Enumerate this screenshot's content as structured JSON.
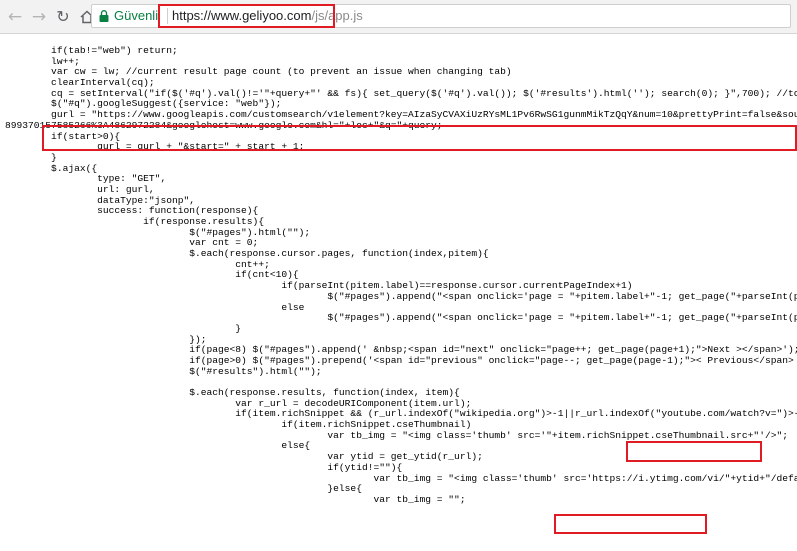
{
  "browser": {
    "secure_label": "Güvenli",
    "url_host": "https://www.geliyoo.com",
    "url_path": "/js/app.js",
    "icons": {
      "back": "back-arrow-icon",
      "forward": "forward-arrow-icon",
      "reload": "reload-icon",
      "home": "home-icon",
      "lock": "lock-icon"
    },
    "secure_color": "#0b8043"
  },
  "annotation_color": "#e01b24",
  "code_lines": [
    "        if(tab!=\"web\") return;",
    "        lw++;",
    "        var cw = lw; //current result page count (to prevent an issue when changing tab)",
    "        clearInterval(cq);",
    "        cq = setInterval(\"if($('#q').val()!='\"+query+\"' && fs){ set_query($('#q').val()); $('#results').html(''); search(0); }\",700); //to che",
    "        $(\"#q\").googleSuggest({service: \"web\"});",
    "        gurl = \"https://www.googleapis.com/customsearch/v1element?key=AIzaSyCVAXiUzRYsML1Pv6RwSG1gunmMikTzQqY&num=10&prettyPrint=false&source=",
    "899370157585266%3A4862972284&googlehost=www.google.com&hl=\"+loc+\"&q=\"+query;",
    "        if(start>0){",
    "                gurl = gurl + \"&start=\" + start + 1;",
    "        }",
    "        $.ajax({",
    "                type: \"GET\",",
    "                url: gurl,",
    "                dataType:\"jsonp\",",
    "                success: function(response){",
    "                        if(response.results){",
    "                                $(\"#pages\").html(\"\");",
    "                                var cnt = 0;",
    "                                $.each(response.cursor.pages, function(index,pitem){",
    "                                        cnt++;",
    "                                        if(cnt<10){",
    "                                                if(parseInt(pitem.label)==response.cursor.currentPageIndex+1)",
    "                                                        $(\"#pages\").append(\"<span onclick='page = \"+pitem.label+\"-1; get_page(\"+parseInt(pitem",
    "                                                else",
    "                                                        $(\"#pages\").append(\"<span onclick='page = \"+pitem.label+\"-1; get_page(\"+parseInt(pitem",
    "                                        }",
    "                                });",
    "                                if(page<8) $(\"#pages\").append(' &nbsp;<span id=\"next\" onclick=\"page++; get_page(page+1);\">Next ></span>');",
    "                                if(page>0) $(\"#pages\").prepend('<span id=\"previous\" onclick=\"page--; get_page(page-1);\">< Previous</span> &nbs",
    "                                $(\"#results\").html(\"\");",
    "",
    "                                $.each(response.results, function(index, item){",
    "                                        var r_url = decodeURIComponent(item.url);",
    "                                        if(item.richSnippet && (r_url.indexOf(\"wikipedia.org\")>-1||r_url.indexOf(\"youtube.com/watch?v=\")>-1||r",
    "                                                if(item.richSnippet.cseThumbnail)",
    "                                                        var tb_img = \"<img class='thumb' src='\"+item.richSnippet.cseThumbnail.src+\"'/>\";",
    "                                                else{",
    "                                                        var ytid = get_ytid(r_url);",
    "                                                        if(ytid!=\"\"){",
    "                                                                var tb_img = \"<img class='thumb' src='https://i.ytimg.com/vi/\"+ytid+\"/default.",
    "                                                        }else{",
    "                                                                var tb_img = \"\";"
  ]
}
